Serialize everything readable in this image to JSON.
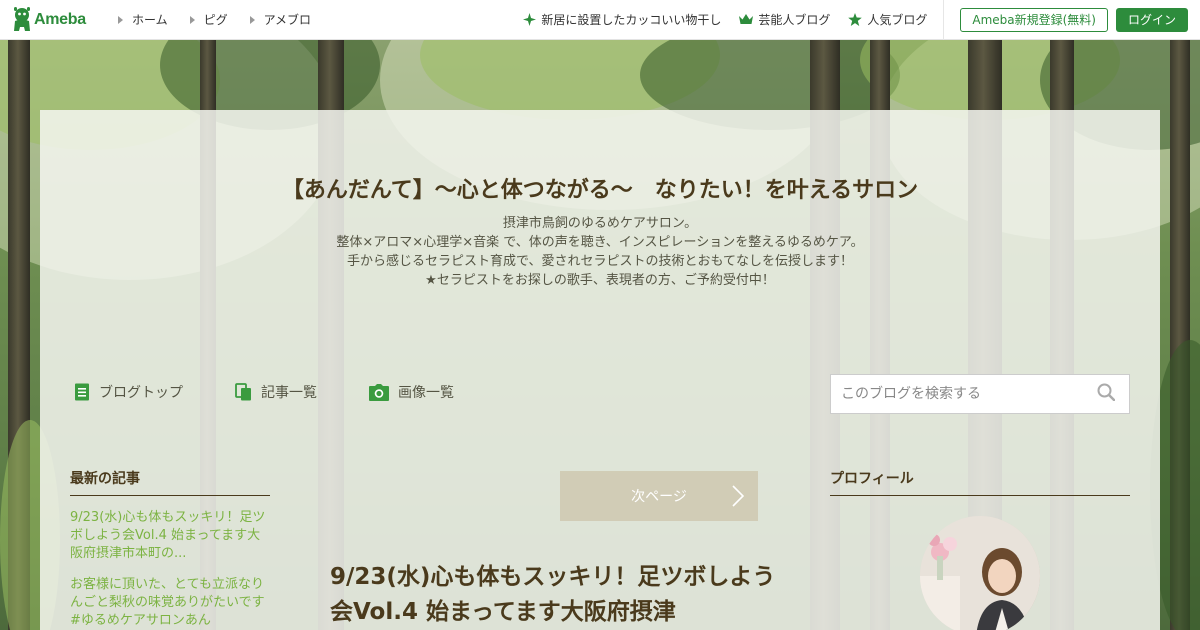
{
  "header": {
    "logo_text": "Ameba",
    "nav_left": [
      "ホーム",
      "ピグ",
      "アメブロ"
    ],
    "nav_right": [
      {
        "label": "新居に設置したカッコいい物干し",
        "icon": "sparkle-icon"
      },
      {
        "label": "芸能人ブログ",
        "icon": "crown-icon"
      },
      {
        "label": "人気ブログ",
        "icon": "star-icon"
      }
    ],
    "register_label": "Ameba新規登録(無料)",
    "login_label": "ログイン",
    "brand_color": "#2d8c3c"
  },
  "blog": {
    "title": "【あんだんて】～心と体つながる～　なりたい！を叶えるサロン",
    "description": [
      "摂津市鳥飼のゆるめケアサロン。",
      "整体×アロマ×心理学×音楽 で、体の声を聴き、インスピレーションを整えるゆるめケア。",
      "手から感じるセラピスト育成で、愛されセラピストの技術とおもてなしを伝授します！",
      "★セラピストをお探しの歌手、表現者の方、ご予約受付中！"
    ]
  },
  "blog_nav": [
    {
      "label": "ブログトップ",
      "icon": "document-icon"
    },
    {
      "label": "記事一覧",
      "icon": "copy-icon"
    },
    {
      "label": "画像一覧",
      "icon": "camera-icon"
    }
  ],
  "search": {
    "placeholder": "このブログを検索する"
  },
  "latest": {
    "heading": "最新の記事",
    "items": [
      "9/23(水)心も体もスッキリ！足ツボしよう会Vol.4 始まってます大阪府摂津市本町の...",
      "お客様に頂いた、とても立派なりんごと梨秋の味覚ありがたいです#ゆるめケアサロンあん"
    ]
  },
  "pager": {
    "next_label": "次ページ"
  },
  "post": {
    "title": "9/23(水)心も体もスッキリ！足ツボしよう会Vol.4 始まってます大阪府摂津"
  },
  "profile": {
    "heading": "プロフィール"
  }
}
